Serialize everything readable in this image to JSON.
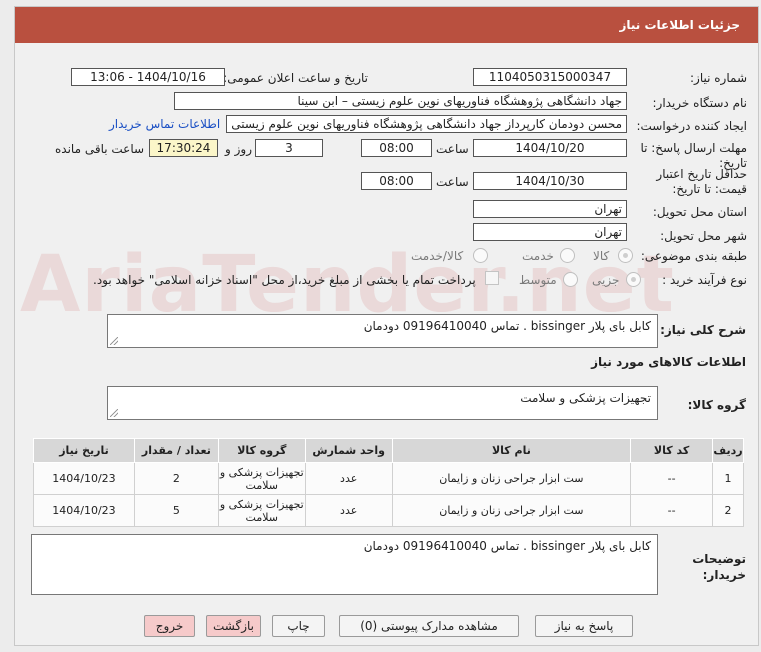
{
  "panel": {
    "title": "جزئیات اطلاعات نیاز"
  },
  "labels": {
    "need_number": "شماره نیاز:",
    "announce_datetime": "تاریخ و ساعت اعلان عمومی:",
    "buyer_org": "نام دستگاه خریدار:",
    "requester": "ایجاد کننده درخواست:",
    "send_deadline": "مهلت ارسال پاسخ: تا تاریخ:",
    "time": "ساعت",
    "days_and": "روز و",
    "remaining": "ساعت باقی مانده",
    "price_validity": "حداقل تاریخ اعتبار قیمت: تا تاریخ:",
    "province": "استان محل تحویل:",
    "city": "شهر محل تحویل:",
    "category": "طبقه بندی موضوعی:",
    "process_type": "نوع فرآیند خرید :",
    "description": "شرح کلی نیاز:",
    "goods_info": "اطلاعات کالاهای مورد نیاز",
    "goods_group": "گروه کالا:",
    "buyer_notes": "توضیحات خریدار:"
  },
  "fields": {
    "need_number": "1104050315000347",
    "announce_datetime": "1404/10/16 - 13:06",
    "buyer_org": "جهاد دانشگاهی پژوهشگاه فناوریهای نوین علوم زیستی – ابن سینا",
    "requester": "محسن دودمان کارپرداز جهاد دانشگاهی پژوهشگاه فناوریهای نوین علوم زیستی",
    "contact_link": "اطلاعات تماس خریدار",
    "send_date": "1404/10/20",
    "send_time": "08:00",
    "days": "3",
    "remaining_time": "17:30:24",
    "validity_date": "1404/10/30",
    "validity_time": "08:00",
    "province": "تهران",
    "city": "تهران"
  },
  "category_options": [
    {
      "label": "کالا",
      "selected": true
    },
    {
      "label": "خدمت",
      "selected": false
    },
    {
      "label": "کالا/خدمت",
      "selected": false
    }
  ],
  "process_options": [
    {
      "label": "جزیی",
      "selected": true
    },
    {
      "label": "متوسط",
      "selected": false
    }
  ],
  "payment_note": "پرداخت تمام یا بخشی از مبلغ خرید،از محل \"اسناد خزانه اسلامی\" خواهد بود.",
  "description_text": "کابل بای پلار bissinger . تماس 09196410040 دودمان",
  "goods_group_text": "تجهیزات پزشکی و سلامت",
  "table": {
    "headers": [
      "ردیف",
      "کد کالا",
      "نام کالا",
      "واحد شمارش",
      "گروه کالا",
      "تعداد / مقدار",
      "تاریخ نیاز"
    ],
    "rows": [
      [
        "1",
        "--",
        "ست ابزار جراحی زنان و زایمان",
        "عدد",
        "تجهیزات پزشکی و سلامت",
        "2",
        "1404/10/23"
      ],
      [
        "2",
        "--",
        "ست ابزار جراحی زنان و زایمان",
        "عدد",
        "تجهیزات پزشکی و سلامت",
        "5",
        "1404/10/23"
      ]
    ]
  },
  "buyer_notes_text": "کابل بای پلار bissinger . تماس 09196410040 دودمان",
  "buttons": {
    "reply": "پاسخ به نیاز",
    "attachments": "مشاهده مدارک پیوستی (0)",
    "print": "چاپ",
    "back": "بازگشت",
    "exit": "خروج"
  },
  "watermark": "AriaTender.net"
}
